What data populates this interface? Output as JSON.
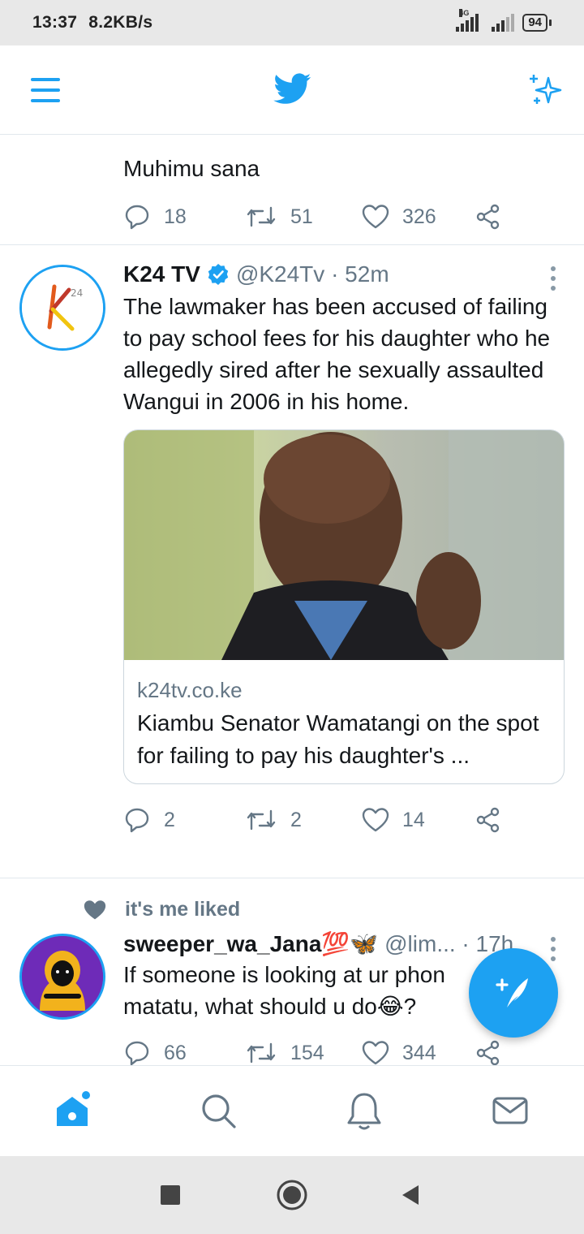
{
  "status_bar": {
    "time": "13:37",
    "speed": "8.2KB/s",
    "network": "4G",
    "battery": "94"
  },
  "top_nav": {
    "menu_icon": "hamburger-icon",
    "logo_icon": "twitter-bird-icon",
    "spark_icon": "sparkle-icon"
  },
  "tweets": [
    {
      "text": "Muhimu sana",
      "replies": "18",
      "retweets": "51",
      "likes": "326"
    },
    {
      "name": "K24 TV",
      "handle": "@K24Tv · 52m",
      "verified": true,
      "text": "The lawmaker has been accused of failing to pay school fees for his daughter who he allegedly sired after he sexually assaulted Wangui in 2006 in his home.",
      "card": {
        "domain": "k24tv.co.ke",
        "title": "Kiambu Senator Wamatangi on the spot for failing to pay his daughter's ..."
      },
      "replies": "2",
      "retweets": "2",
      "likes": "14"
    },
    {
      "social_context": "it's me liked",
      "name": "sweeper_wa_Jana💯🦋",
      "handle": "@lim... · 17h",
      "text": "If someone is looking at ur phone in a matatu, what should  u do😂?",
      "text_visible": "If someone is looking at ur phon",
      "text_line2": "matatu, what should  u do😂?",
      "replies": "66",
      "retweets": "154",
      "likes": "344"
    }
  ],
  "bottom_tabs": [
    "home-icon",
    "search-icon",
    "notifications-icon",
    "messages-icon"
  ],
  "colors": {
    "accent": "#1da1f2",
    "secondary_text": "#657786",
    "divider": "#e1e8ed"
  }
}
